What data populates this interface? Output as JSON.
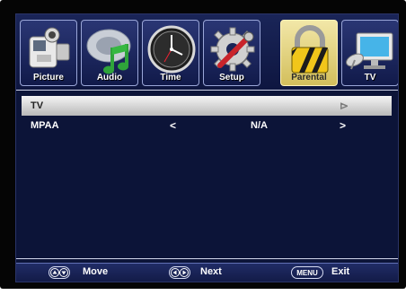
{
  "tabs": [
    {
      "label": "Picture",
      "icon": "camcorder-icon"
    },
    {
      "label": "Audio",
      "icon": "music-note-icon"
    },
    {
      "label": "Time",
      "icon": "clock-icon"
    },
    {
      "label": "Setup",
      "icon": "gear-wrench-icon"
    },
    {
      "label": "Parental",
      "icon": "padlock-icon",
      "selected": true
    },
    {
      "label": "TV",
      "icon": "satellite-monitor-icon"
    }
  ],
  "menu": {
    "rows": [
      {
        "label": "TV",
        "selected": true,
        "value": "",
        "right_arrow": "⊳"
      },
      {
        "label": "MPAA",
        "selected": false,
        "value": "N/A",
        "left_arrow": "<",
        "right_arrow": ">"
      }
    ]
  },
  "hints": {
    "move_label": "Move",
    "next_label": "Next",
    "menu_key": "MENU",
    "exit_label": "Exit"
  },
  "colors": {
    "screen_bg": "#0c1438",
    "selected_tab": "#e6d58a",
    "selected_row": "#d9d9d9"
  }
}
